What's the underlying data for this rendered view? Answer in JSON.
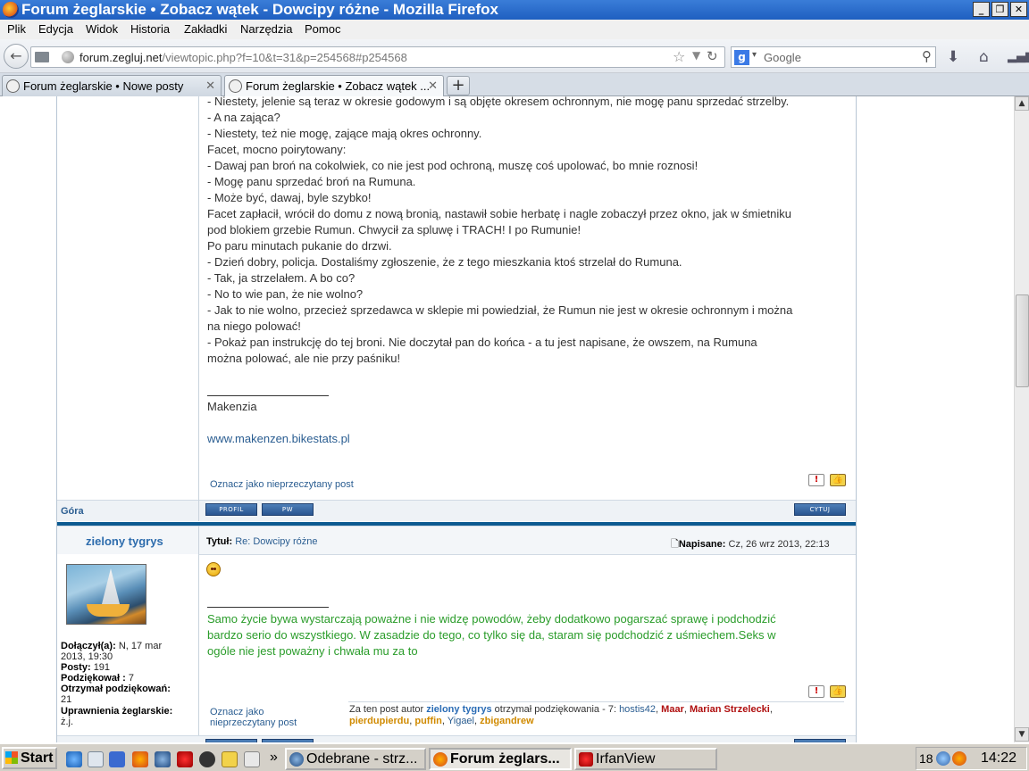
{
  "window": {
    "title": "Forum żeglarskie • Zobacz wątek - Dowcipy różne - Mozilla Firefox",
    "minimize": "_",
    "restore": "❐",
    "close": "✕"
  },
  "menu": [
    "Plik",
    "Edycja",
    "Widok",
    "Historia",
    "Zakładki",
    "Narzędzia",
    "Pomoc"
  ],
  "nav": {
    "url_host": "forum.zegluj.net",
    "url_path": "/viewtopic.php?f=10&t=31&p=254568#p254568",
    "search_placeholder": "Google"
  },
  "tabs": [
    {
      "label": "Forum żeglarskie • Nowe posty",
      "active": false
    },
    {
      "label": "Forum żeglarskie • Zobacz wątek ...",
      "active": true
    }
  ],
  "post1": {
    "lines": [
      "- Niestety, jelenie są teraz w okresie godowym i są objęte okresem ochronnym, nie mogę panu sprzedać strzelby.",
      "- A na zająca?",
      "- Niestety, też nie mogę, zające mają okres ochronny.",
      "Facet, mocno poirytowany:",
      "- Dawaj pan broń na cokolwiek, co nie jest pod ochroną, muszę coś upolować, bo mnie roznosi!",
      "- Mogę panu sprzedać broń na Rumuna.",
      "- Może być, dawaj, byle szybko!",
      "Facet zapłacił, wrócił do domu z nową bronią, nastawił sobie herbatę i nagle zobaczył przez okno, jak w śmietniku",
      "pod blokiem grzebie Rumun. Chwycił za spluwę i TRACH! I po Rumunie!",
      "Po paru minutach pukanie do drzwi.",
      "- Dzień dobry, policja. Dostaliśmy zgłoszenie, że z tego mieszkania ktoś strzelał do Rumuna.",
      "- Tak, ja strzelałem. A bo co?",
      "- No to wie pan, że nie wolno?",
      "- Jak to nie wolno, przecież sprzedawca w sklepie mi powiedział, że Rumun nie jest w okresie ochronnym i można",
      "na niego polować!",
      "- Pokaż pan instrukcję do tej broni. Nie doczytał pan do końca - a tu jest napisane, że owszem, na Rumuna",
      "można polować, ale nie przy paśniku!"
    ],
    "signature_name": "Makenzia",
    "signature_link": "www.makenzen.bikestats.pl",
    "mark_unread": "Oznacz jako nieprzeczytany post",
    "report_icon": "!",
    "thanks_icon": "👍"
  },
  "bar1": {
    "top_link": "Góra",
    "profile_btn": "PROFIL",
    "pm_btn": "PW",
    "quote_btn": "CYTUJ"
  },
  "post2": {
    "author": "zielony tygrys",
    "title_label": "Tytuł:",
    "title_value": "Re: Dowcipy różne",
    "posted_label": "Napisane:",
    "posted_value": "Cz, 26 wrz 2013, 22:13",
    "joined_label": "Dołączył(a):",
    "joined_value_1": "N, 17 mar",
    "joined_value_2": "2013, 19:30",
    "posts_label": "Posty:",
    "posts_value": "191",
    "thanked_label": "Podziękował :",
    "thanked_value": "7",
    "received_label": "Otrzymał podziękowań:",
    "received_value": "21",
    "rights_label": "Uprawnienia żeglarskie:",
    "rights_value": "ż.j.",
    "signature": [
      "Samo życie bywa wystarczają poważne i nie widzę powodów, żeby dodatkowo pogarszać sprawę i podchodzić",
      "bardzo serio do wszystkiego. W zasadzie do tego, co tylko się da, staram się podchodzić z uśmiechem.Seks w",
      "ogóle nie jest poważny i chwała mu za to"
    ],
    "mark_unread_1": "Oznacz jako",
    "mark_unread_2": "nieprzeczytany post",
    "thanks_prefix": "Za ten post autor",
    "thanks_author": "zielony tygrys",
    "thanks_mid": "otrzymał podziękowania - 7:",
    "thanks_users": [
      "hostis42",
      "Maar",
      "Marian Strzelecki",
      "pierdupierdu",
      "puffin",
      "Yigael",
      "zbigandrew"
    ]
  },
  "taskbar": {
    "start": "Start",
    "more": "»",
    "tasks": [
      {
        "label": "Odebrane - strz...",
        "active": false
      },
      {
        "label": "Forum żeglars...",
        "active": true
      },
      {
        "label": "IrfanView",
        "active": false
      }
    ],
    "tray_num": "18",
    "clock": "14:22"
  },
  "colors": {
    "accent_blue": "#0c5a91",
    "link_blue": "#2a5d91",
    "signature_green": "#2a9c2a"
  }
}
